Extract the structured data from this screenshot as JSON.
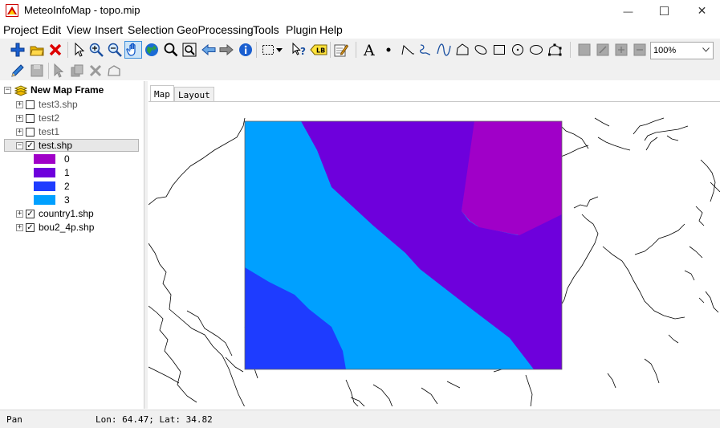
{
  "window": {
    "title": "MeteoInfoMap - topo.mip",
    "minimize_glyph": "—",
    "maximize_glyph": "☐",
    "close_glyph": "✕"
  },
  "menu": {
    "items": [
      "Project",
      "Edit",
      "View",
      "Insert",
      "Selection",
      "GeoProcessing",
      "Tools",
      "Plugin",
      "Help"
    ]
  },
  "toolbar": {
    "zoom_value": "100%",
    "label_tool_text": "LB",
    "icons_row1": [
      "add-layer-icon",
      "open-folder-icon",
      "remove-layer-icon",
      "select-pointer-icon",
      "zoom-in-icon",
      "zoom-out-icon",
      "pan-hand-icon",
      "full-extent-globe-icon",
      "magnifier-icon",
      "zoom-box-icon",
      "back-arrow-icon",
      "forward-arrow-icon",
      "identify-info-icon",
      "select-rectangle-icon",
      "dropdown-caret-icon",
      "help-cursor-icon",
      "label-tool-icon",
      "edit-properties-icon",
      "text-icon",
      "point-icon",
      "polyline-icon",
      "freehand-icon",
      "curve-icon",
      "polygon-icon",
      "ellipse-tilted-icon",
      "rectangle-icon",
      "circle-icon",
      "ellipse-icon",
      "edit-vertices-icon",
      "page-icon",
      "page-fit-icon",
      "page-zoom-in-icon",
      "page-zoom-out-icon"
    ],
    "icons_row2": [
      "edit-pencil-icon",
      "save-edits-icon",
      "select-feature-icon",
      "copy-feature-icon",
      "delete-feature-icon",
      "add-vertex-icon"
    ]
  },
  "legend": {
    "frame_name": "New Map Frame",
    "layers": [
      {
        "name": "test3.shp",
        "checked": false,
        "expanded": false
      },
      {
        "name": "test2",
        "checked": false,
        "expanded": false
      },
      {
        "name": "test1",
        "checked": false,
        "expanded": false
      },
      {
        "name": "test.shp",
        "checked": true,
        "expanded": true
      },
      {
        "name": "country1.shp",
        "checked": true,
        "expanded": false
      },
      {
        "name": "bou2_4p.shp",
        "checked": true,
        "expanded": false
      }
    ],
    "classes": [
      {
        "label": "0",
        "color": "#a000c8"
      },
      {
        "label": "1",
        "color": "#6e00dc"
      },
      {
        "label": "2",
        "color": "#1e3cff"
      },
      {
        "label": "3",
        "color": "#00a0ff"
      }
    ],
    "check_mark": "✓",
    "expand_glyph": "+",
    "collapse_glyph": "−"
  },
  "tabs": [
    "Map",
    "Layout"
  ],
  "status": {
    "mode": "Pan",
    "coords": "Lon: 64.47; Lat: 34.82"
  },
  "colors": {
    "class0": "#a000c8",
    "class1": "#6e00dc",
    "class2": "#1e3cff",
    "class3": "#00a0ff"
  }
}
